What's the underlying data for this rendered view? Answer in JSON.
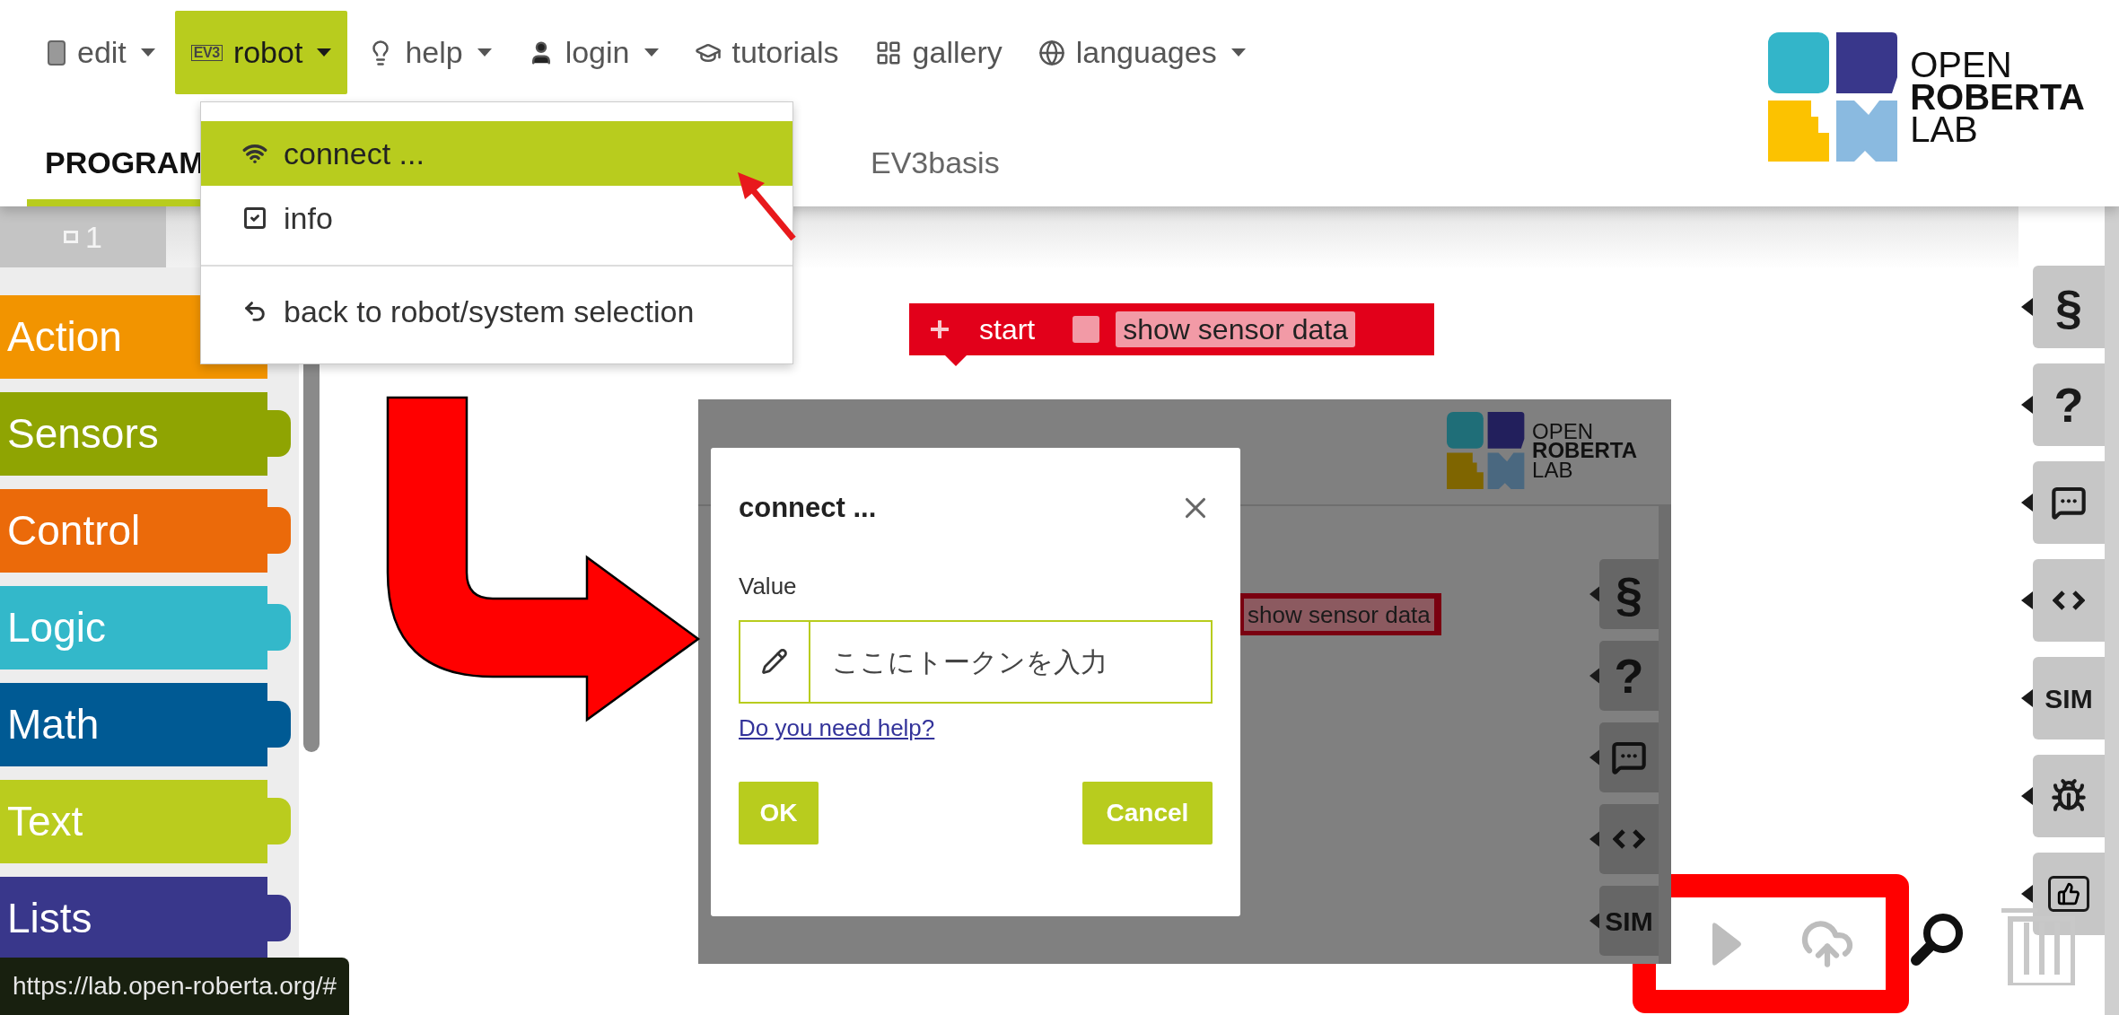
{
  "navbar": {
    "items": [
      {
        "kind": "document",
        "label": "edit",
        "dropdown": true,
        "selected": false
      },
      {
        "kind": "ev3",
        "badge": "EV3",
        "label": "robot",
        "dropdown": true,
        "selected": true
      },
      {
        "kind": "bulb",
        "label": "help",
        "dropdown": true,
        "selected": false
      },
      {
        "kind": "user",
        "label": "login",
        "dropdown": true,
        "selected": false
      },
      {
        "kind": "cap",
        "label": "tutorials",
        "dropdown": false,
        "selected": false
      },
      {
        "kind": "grid",
        "label": "gallery",
        "dropdown": false,
        "selected": false
      },
      {
        "kind": "globe",
        "label": "languages",
        "dropdown": true,
        "selected": false
      }
    ]
  },
  "logo": {
    "lines": [
      "OPEN",
      "ROBERTA",
      "LAB"
    ]
  },
  "tabs": [
    {
      "label": "PROGRAM",
      "selected": true
    },
    {
      "label": "EV3basis",
      "selected": false
    }
  ],
  "robot_menu": {
    "items": [
      {
        "kind": "wifi",
        "label": "connect ...",
        "selected": true,
        "separated": false
      },
      {
        "kind": "check",
        "label": "info",
        "selected": false,
        "separated": false
      },
      {
        "kind": "back",
        "label": "back to robot/system selection",
        "selected": false,
        "separated": true
      }
    ]
  },
  "workspace_tab": {
    "label": "1"
  },
  "categories": [
    {
      "label": "Action",
      "color": "#f29400"
    },
    {
      "label": "Sensors",
      "color": "#8fa402"
    },
    {
      "label": "Control",
      "color": "#eb6a0a"
    },
    {
      "label": "Logic",
      "color": "#33b8ca"
    },
    {
      "label": "Math",
      "color": "#005a94"
    },
    {
      "label": "Text",
      "color": "#bacc1e"
    },
    {
      "label": "Lists",
      "color": "#39378b"
    }
  ],
  "start_block": {
    "label": "start",
    "checked": false,
    "option": "show sensor data"
  },
  "side_buttons": [
    {
      "kind": "text",
      "label": "§"
    },
    {
      "kind": "text",
      "label": "?"
    },
    {
      "kind": "speech"
    },
    {
      "kind": "code"
    },
    {
      "kind": "text",
      "label": "SIM"
    },
    {
      "kind": "bug"
    },
    {
      "kind": "feedback"
    }
  ],
  "status_url": "https://lab.open-roberta.org/#",
  "inset": {
    "logo": {
      "lines": [
        "OPEN",
        "ROBERTA",
        "LAB"
      ]
    },
    "start_option": "show sensor data",
    "side_buttons": [
      {
        "kind": "text",
        "label": "§"
      },
      {
        "kind": "text",
        "label": "?"
      },
      {
        "kind": "speech"
      },
      {
        "kind": "code"
      },
      {
        "kind": "text",
        "label": "SIM"
      }
    ],
    "dialog": {
      "title": "connect ...",
      "field_label": "Value",
      "placeholder": "ここにトークンを入力",
      "help_link": "Do you need help?",
      "buttons": [
        {
          "kind": "primary",
          "label": "OK"
        },
        {
          "kind": "secondary",
          "label": "Cancel"
        }
      ]
    }
  }
}
